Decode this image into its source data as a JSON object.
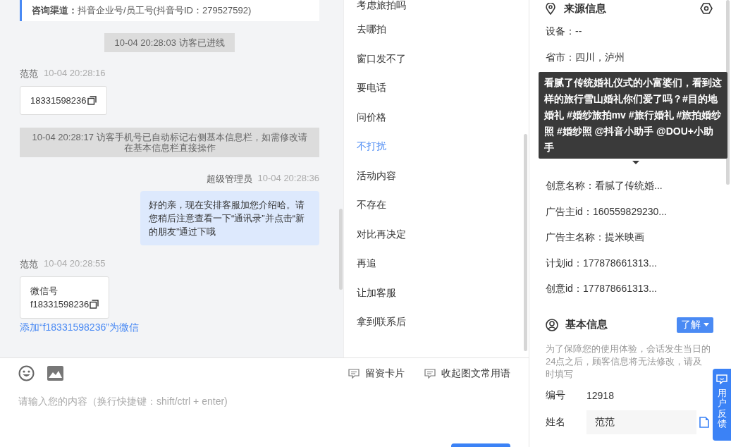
{
  "chat": {
    "messages": [
      {
        "kind": "channel",
        "label": "咨询渠道：",
        "value": "抖音企业号/员工号(抖音号ID：279527592)"
      },
      {
        "kind": "system",
        "text": "10-04 20:28:03 访客已进线"
      },
      {
        "kind": "visitor",
        "sender": "范范",
        "time": "10-04 20:28:16",
        "lines": [
          "18331598236"
        ]
      },
      {
        "kind": "system",
        "text": "10-04 20:28:17 访客手机号已自动标记右侧基本信息栏，如需修改请在基本信息栏直接操作"
      },
      {
        "kind": "agent",
        "sender": "超级管理员",
        "time": "10-04 20:28:36",
        "text": "好的亲，现在安排客服加您介绍哈。请您稍后注意查看一下“通讯录”并点击“新的朋友”通过下哦"
      },
      {
        "kind": "visitor",
        "sender": "范范",
        "time": "10-04 20:28:55",
        "lines": [
          "微信号",
          "f18331598236"
        ],
        "link": "添加“f18331598236”为微信"
      }
    ]
  },
  "quick_replies": [
    {
      "label": "考虑旅拍吗",
      "selected": false
    },
    {
      "label": "去哪拍",
      "selected": false
    },
    {
      "label": "窗口发不了",
      "selected": false
    },
    {
      "label": "要电话",
      "selected": false
    },
    {
      "label": "问价格",
      "selected": false
    },
    {
      "label": "不打扰",
      "selected": true
    },
    {
      "label": "活动内容",
      "selected": false
    },
    {
      "label": "不存在",
      "selected": false
    },
    {
      "label": "对比再决定",
      "selected": false
    },
    {
      "label": "再追",
      "selected": false
    },
    {
      "label": "让加客服",
      "selected": false
    },
    {
      "label": "拿到联系后",
      "selected": false
    }
  ],
  "composer": {
    "tools": [
      "留资卡片",
      "收起图文常用语"
    ],
    "placeholder": "请输入您的内容（换行快捷键：shift/ctrl + enter)"
  },
  "source_info": {
    "title": "来源信息",
    "rows_top": [
      "设备：--",
      "省市：四川，泸州"
    ],
    "tooltip": "看腻了传统婚礼仪式的小富婆们，看到这样的旅行雪山婚礼你们爱了吗？#目的地婚礼 #婚纱旅拍mv #旅行婚礼 #旅拍婚纱照 #婚纱照 @抖音小助手 @DOU+小助手",
    "rows_bottom": [
      "创意名称：看腻了传统婚...",
      "广告主id：160559829230...",
      "广告主名称：提米映画",
      "计划id：177878661313...",
      "创意id：177878661313..."
    ]
  },
  "basic_info": {
    "title": "基本信息",
    "tag": "了解",
    "note": "为了保障您的使用体验，会话发生当日的24点之后，顾客信息将无法修改，请及时填写",
    "fields": [
      {
        "kind": "text",
        "label": "编号",
        "value": "12918"
      },
      {
        "kind": "input",
        "label": "姓名",
        "value": "范范"
      }
    ]
  },
  "feedback": {
    "label": "用户反馈"
  }
}
